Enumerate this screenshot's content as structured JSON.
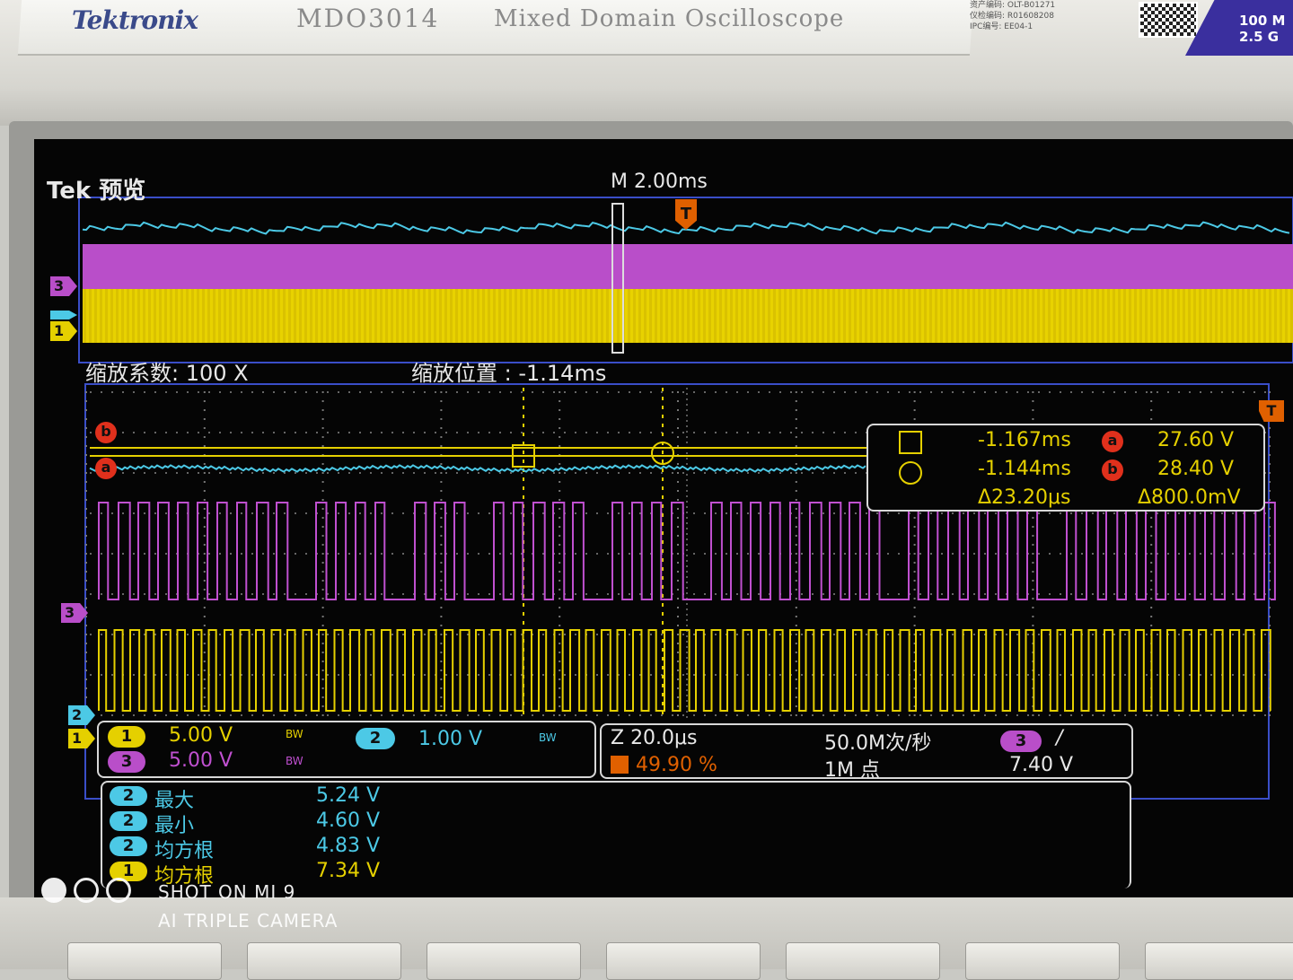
{
  "header": {
    "brand": "Tektronix",
    "model": "MDO3014",
    "model_desc": "Mixed Domain Oscilloscope",
    "asset_lines": [
      "资产编码: OLT-B01271",
      "仪检编码: R01608208",
      "IPC编号: EE04-1"
    ],
    "spec_lines": [
      "100 M",
      "2.5 G"
    ]
  },
  "screen": {
    "tek_label": "Tek 预览",
    "record_timebase": "M 2.00ms",
    "trigger_marker": "T",
    "zoom_factor": "缩放系数: 100 X",
    "zoom_position": "缩放位置 :  -1.14ms",
    "trigger_pos_marker": "T"
  },
  "cursor_readout": {
    "row1_time": "-1.167ms",
    "row1_tag": "a",
    "row1_volt": "27.60 V",
    "row2_time": "-1.144ms",
    "row2_tag": "b",
    "row2_volt": "28.40 V",
    "delta_time": "Δ23.20μs",
    "delta_volt": "Δ800.0mV"
  },
  "cursors": {
    "b_label": "b",
    "a_label": "a"
  },
  "channels": {
    "ch1": {
      "num": "1",
      "scale": "5.00 V",
      "bw": "BW",
      "color": "#e5d000"
    },
    "ch2": {
      "num": "2",
      "scale": "1.00 V",
      "bw": "BW",
      "color": "#4cc9e6"
    },
    "ch3": {
      "num": "3",
      "scale": "5.00 V",
      "bw": "BW",
      "color": "#b94ec9"
    }
  },
  "timebase": {
    "zoom_scale": "Z 20.0μs",
    "trigger_position": "49.90 %",
    "sample_rate": "50.0M次/秒",
    "record_length": "1M 点",
    "trigger_source": "3",
    "trigger_slope": "/",
    "trigger_level": "7.40 V"
  },
  "measurements": [
    {
      "ch": "2",
      "name": "最大",
      "value": "5.24 V"
    },
    {
      "ch": "2",
      "name": "最小",
      "value": "4.60 V"
    },
    {
      "ch": "2",
      "name": "均方根",
      "value": "4.83 V"
    },
    {
      "ch": "1",
      "name": "均方根",
      "value": "7.34 V"
    }
  ],
  "watermark": {
    "line1": "SHOT ON MI 9",
    "line2": "AI TRIPLE CAMERA"
  }
}
